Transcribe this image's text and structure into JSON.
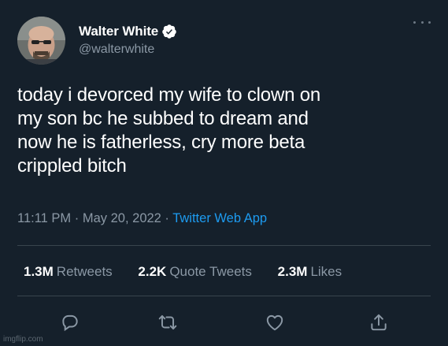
{
  "user": {
    "display_name": "Walter White",
    "handle": "@walterwhite",
    "avatar_icon": "walter-white-avatar",
    "verified_icon": "verified-badge-icon"
  },
  "tweet": {
    "text": "today i devorced my wife to clown on\nmy son bc he subbed to dream and\nnow he is fatherless, cry more beta\ncrippled bitch",
    "time": "11:11 PM",
    "separator": " · ",
    "date": "May 20, 2022",
    "source": "Twitter Web App"
  },
  "stats": {
    "retweets_count": "1.3M",
    "retweets_label": "Retweets",
    "quotes_count": "2.2K",
    "quotes_label": "Quote Tweets",
    "likes_count": "2.3M",
    "likes_label": "Likes"
  },
  "actions": [
    "reply-icon",
    "retweet-icon",
    "like-icon",
    "share-icon"
  ],
  "watermark": "imgflip.com",
  "colors": {
    "background": "#15202b",
    "text": "#ffffff",
    "secondary": "#8b98a5",
    "link": "#1d9bf0",
    "divider": "#38444d"
  }
}
